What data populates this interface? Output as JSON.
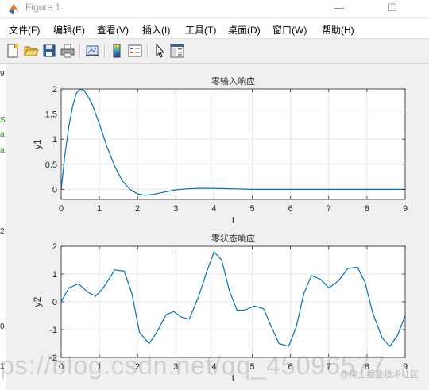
{
  "window": {
    "title": "Figure 1",
    "minimize": "—",
    "maximize": "☐"
  },
  "menu": [
    "文件(F)",
    "编辑(E)",
    "查看(V)",
    "插入(I)",
    "工具(T)",
    "桌面(D)",
    "窗口(W)",
    "帮助(H)"
  ],
  "toolbar": [
    "new-figure-icon",
    "open-folder-icon",
    "save-icon",
    "print-icon",
    "link-plot-icon",
    "colorbar-icon",
    "legend-icon",
    "pointer-icon",
    "property-editor-icon"
  ],
  "left_strip_fragments": [
    "9",
    "S",
    "a",
    "a",
    "2",
    "0",
    "1"
  ],
  "colors": {
    "line": "#0072bd",
    "grid": "#e6e6e6",
    "axes_bg": "#ffffff"
  },
  "chart_data": [
    {
      "type": "line",
      "title": "零输入响应",
      "xlabel": "t",
      "ylabel": "y1",
      "xlim": [
        0,
        9
      ],
      "ylim": [
        -0.2,
        2
      ],
      "xticks": [
        "0",
        "1",
        "2",
        "3",
        "4",
        "5",
        "6",
        "7",
        "8",
        "9"
      ],
      "yticks": [
        "0",
        "0.5",
        "1",
        "1.5",
        "2"
      ],
      "grid": true,
      "series": [
        {
          "x": [
            0,
            0.1,
            0.2,
            0.3,
            0.4,
            0.5,
            0.6,
            0.8,
            1.0,
            1.2,
            1.4,
            1.6,
            1.8,
            2.0,
            2.2,
            2.4,
            2.6,
            2.8,
            3.0,
            3.3,
            3.6,
            3.9,
            4.2,
            4.5,
            5.0,
            5.5,
            6.0,
            7.0,
            8.0,
            9.0
          ],
          "y": [
            0,
            0.7,
            1.25,
            1.65,
            1.92,
            2.0,
            1.97,
            1.72,
            1.3,
            0.85,
            0.46,
            0.17,
            0.0,
            -0.09,
            -0.12,
            -0.1,
            -0.07,
            -0.04,
            -0.01,
            0.01,
            0.02,
            0.02,
            0.015,
            0.01,
            0.0,
            0.0,
            0.0,
            0.0,
            0.0,
            0.0
          ]
        }
      ]
    },
    {
      "type": "line",
      "title": "零状态响应",
      "xlabel": "t",
      "ylabel": "y2",
      "xlim": [
        0,
        9
      ],
      "ylim": [
        -2,
        2
      ],
      "xticks": [
        "0",
        "1",
        "2",
        "3",
        "4",
        "5",
        "6",
        "7",
        "8",
        "9"
      ],
      "yticks": [
        "-2",
        "-1",
        "0",
        "1",
        "2"
      ],
      "grid": true,
      "series": [
        {
          "x": [
            0,
            0.2,
            0.45,
            0.7,
            0.9,
            1.1,
            1.4,
            1.65,
            1.85,
            2.05,
            2.3,
            2.5,
            2.75,
            2.95,
            3.15,
            3.35,
            3.6,
            3.8,
            4.0,
            4.2,
            4.4,
            4.6,
            4.8,
            5.05,
            5.3,
            5.5,
            5.7,
            5.95,
            6.15,
            6.35,
            6.55,
            6.8,
            7.0,
            7.25,
            7.5,
            7.75,
            7.95,
            8.15,
            8.4,
            8.6,
            8.8,
            9.0
          ],
          "y": [
            0.0,
            0.5,
            0.65,
            0.35,
            0.2,
            0.5,
            1.15,
            1.1,
            0.3,
            -1.1,
            -1.5,
            -1.1,
            -0.45,
            -0.35,
            -0.55,
            -0.62,
            0.2,
            1.05,
            1.8,
            1.5,
            0.4,
            -0.3,
            -0.3,
            -0.15,
            -0.25,
            -0.9,
            -1.5,
            -1.6,
            -0.9,
            0.3,
            0.95,
            0.8,
            0.5,
            0.75,
            1.2,
            1.25,
            0.7,
            -0.4,
            -1.3,
            -1.6,
            -1.2,
            -0.5
          ]
        }
      ]
    }
  ],
  "watermark": "ps://blog.csdn.net/qq_45096577",
  "watermark2": "@稀土掘金技术社区"
}
